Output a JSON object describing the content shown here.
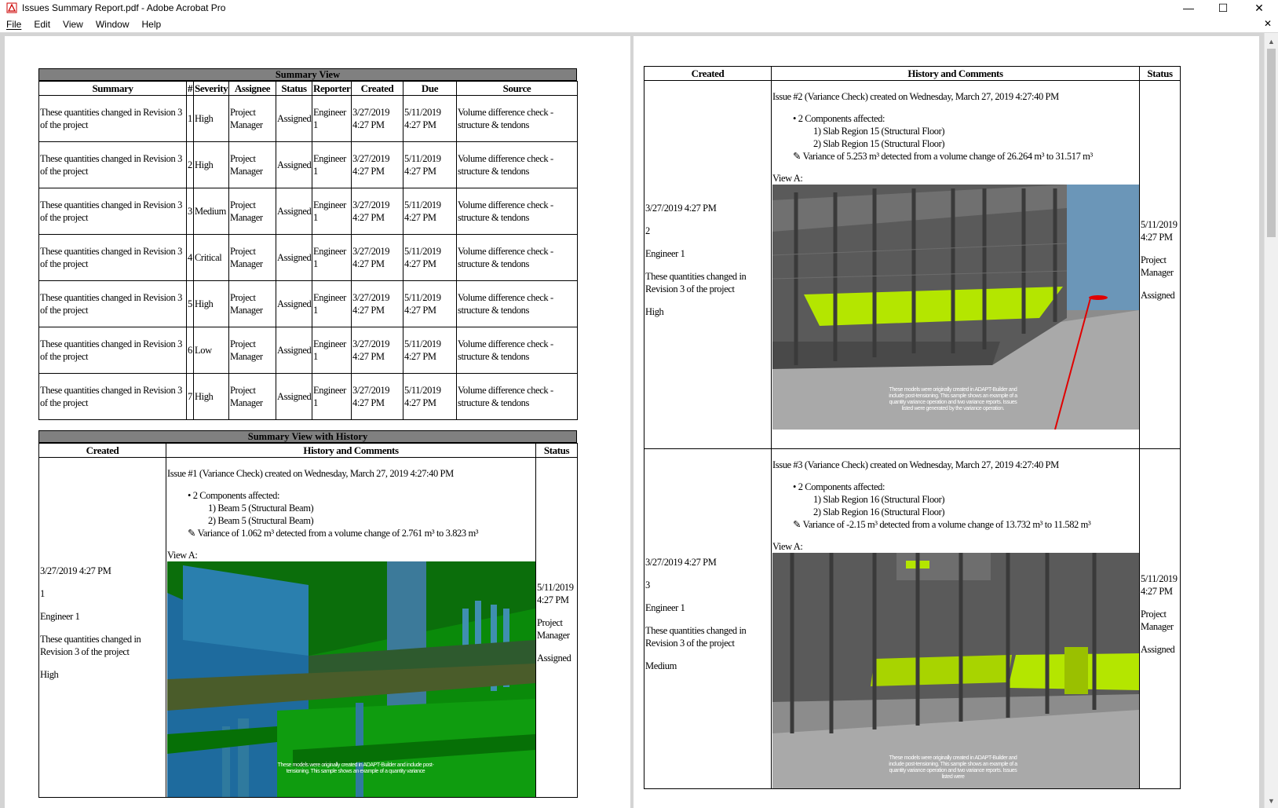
{
  "window": {
    "title": "Issues Summary Report.pdf - Adobe Acrobat Pro",
    "minimize": "—",
    "maximize": "☐",
    "close": "✕"
  },
  "menu": {
    "items": [
      "File",
      "Edit",
      "View",
      "Window",
      "Help"
    ],
    "close_doc": "✕"
  },
  "summary_view": {
    "title": "Summary View",
    "headers": [
      "Summary",
      "#",
      "Severity",
      "Assignee",
      "Status",
      "Reporter",
      "Created",
      "Due",
      "Source"
    ],
    "rows": [
      {
        "summary": "These quantities changed in Revision 3 of the project",
        "num": "1",
        "severity": "High",
        "assignee": "Project Manager",
        "status": "Assigned",
        "reporter": "Engineer 1",
        "created": "3/27/2019 4:27 PM",
        "due": "5/11/2019 4:27 PM",
        "source": "Volume difference check - structure & tendons"
      },
      {
        "summary": "These quantities changed in Revision 3 of the project",
        "num": "2",
        "severity": "High",
        "assignee": "Project Manager",
        "status": "Assigned",
        "reporter": "Engineer 1",
        "created": "3/27/2019 4:27 PM",
        "due": "5/11/2019 4:27 PM",
        "source": "Volume difference check - structure & tendons"
      },
      {
        "summary": "These quantities changed in Revision 3 of the project",
        "num": "3",
        "severity": "Medium",
        "assignee": "Project Manager",
        "status": "Assigned",
        "reporter": "Engineer 1",
        "created": "3/27/2019 4:27 PM",
        "due": "5/11/2019 4:27 PM",
        "source": "Volume difference check - structure & tendons"
      },
      {
        "summary": "These quantities changed in Revision 3 of the project",
        "num": "4",
        "severity": "Critical",
        "assignee": "Project Manager",
        "status": "Assigned",
        "reporter": "Engineer 1",
        "created": "3/27/2019 4:27 PM",
        "due": "5/11/2019 4:27 PM",
        "source": "Volume difference check - structure & tendons"
      },
      {
        "summary": "These quantities changed in Revision 3 of the project",
        "num": "5",
        "severity": "High",
        "assignee": "Project Manager",
        "status": "Assigned",
        "reporter": "Engineer 1",
        "created": "3/27/2019 4:27 PM",
        "due": "5/11/2019 4:27 PM",
        "source": "Volume difference check - structure & tendons"
      },
      {
        "summary": "These quantities changed in Revision 3 of the project",
        "num": "6",
        "severity": "Low",
        "assignee": "Project Manager",
        "status": "Assigned",
        "reporter": "Engineer 1",
        "created": "3/27/2019 4:27 PM",
        "due": "5/11/2019 4:27 PM",
        "source": "Volume difference check - structure & tendons"
      },
      {
        "summary": "These quantities changed in Revision 3 of the project",
        "num": "7",
        "severity": "High",
        "assignee": "Project Manager",
        "status": "Assigned",
        "reporter": "Engineer 1",
        "created": "3/27/2019 4:27 PM",
        "due": "5/11/2019 4:27 PM",
        "source": "Volume difference check - structure & tendons"
      }
    ]
  },
  "history_view": {
    "title": "Summary View with History",
    "headers": [
      "Created",
      "History and Comments",
      "Status"
    ],
    "issues": [
      {
        "created": "3/27/2019 4:27 PM",
        "num": "1",
        "reporter": "Engineer 1",
        "summary": "These quantities changed in Revision 3 of the project",
        "severity": "High",
        "header": "Issue #1 (Variance Check) created on Wednesday, March 27, 2019 4:27:40 PM",
        "components": "• 2 Components affected:",
        "comp1": "1) Beam 5 (Structural Beam)",
        "comp2": "2) Beam 5 (Structural Beam)",
        "variance": "✎  Variance of 1.062 m³ detected from a volume change of 2.761 m³ to 3.823 m³",
        "view_label": "View A:",
        "due": "5/11/2019 4:27 PM",
        "assignee": "Project Manager",
        "status": "Assigned",
        "caption": "These models were originally created in ADAPT-Builder and include post-tensioning. This sample shows an example of a quantity variance"
      },
      {
        "created": "3/27/2019 4:27 PM",
        "num": "2",
        "reporter": "Engineer 1",
        "summary": "These quantities changed in Revision 3 of the project",
        "severity": "High",
        "header": "Issue #2 (Variance Check) created on Wednesday, March 27, 2019 4:27:40 PM",
        "components": "• 2 Components affected:",
        "comp1": "1) Slab Region 15 (Structural Floor)",
        "comp2": "2) Slab Region 15 (Structural Floor)",
        "variance": "✎  Variance of 5.253 m³ detected from a volume change of 26.264 m³ to 31.517 m³",
        "view_label": "View A:",
        "due": "5/11/2019 4:27 PM",
        "assignee": "Project Manager",
        "status": "Assigned",
        "caption": "These models were originally created in ADAPT-Builder and include post-tensioning. This sample shows an example of a quantity variance operation and two variance reports. Issues listed were generated by the variance operation."
      },
      {
        "created": "3/27/2019 4:27 PM",
        "num": "3",
        "reporter": "Engineer 1",
        "summary": "These quantities changed in Revision 3 of the project",
        "severity": "Medium",
        "header": "Issue #3 (Variance Check) created on Wednesday, March 27, 2019 4:27:40 PM",
        "components": "• 2 Components affected:",
        "comp1": "1) Slab Region 16 (Structural Floor)",
        "comp2": "2) Slab Region 16 (Structural Floor)",
        "variance": "✎  Variance of -2.15 m³ detected from a volume change of 13.732 m³ to 11.582 m³",
        "view_label": "View A:",
        "due": "5/11/2019 4:27 PM",
        "assignee": "Project Manager",
        "status": "Assigned",
        "caption": "These models were originally created in ADAPT-Builder and include post-tensioning. This sample shows an example of a quantity variance operation and two variance reports. Issues listed were"
      }
    ]
  },
  "colors": {
    "header_bar": "#808080",
    "viewport_green": "#0a8a0a",
    "slab_highlight": "#b4e600",
    "sky": "#6b96b8"
  }
}
